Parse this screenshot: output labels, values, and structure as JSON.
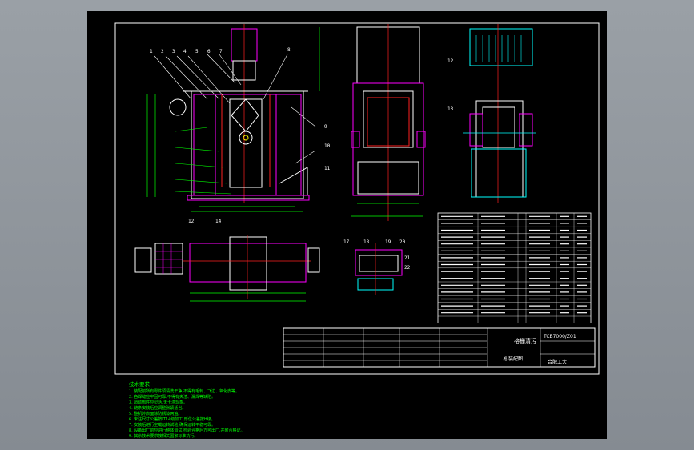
{
  "drawing": {
    "title_cn": "格栅清污",
    "part_no": "TCB7000/Z01",
    "stamp": "合肥工大",
    "scale_note": "总装配图"
  },
  "balloons_main": [
    "1",
    "2",
    "3",
    "4",
    "5",
    "6",
    "7",
    "8",
    "9",
    "10",
    "11"
  ],
  "balloons_side": [
    "12",
    "13"
  ],
  "balloons_plan": [
    "12",
    "14"
  ],
  "balloons_detail": [
    "17",
    "18",
    "19",
    "20",
    "21",
    "22"
  ],
  "bom_rows": 15,
  "notes": [
    "技术要求",
    "1. 装配前所有零件须清洗干净,不得有毛刺、飞边、氧化皮等。",
    "2. 各焊缝应牢固可靠,不得有夹渣、漏焊等缺陷。",
    "3. 运动部件应灵活,无卡滞现象。",
    "4. 链条安装后应调整张紧适当。",
    "5. 整机外表面涂防锈漆两遍。",
    "6. 未注尺寸公差按IT14级加工,形位公差按H级。",
    "7. 安装后进行空载运转试验,确保运转平稳可靠。",
    "8. 设备出厂前应进行整体调试,检验合格后方可出厂,并附合格证。",
    "9. 其余技术要求按相关国家标准执行。"
  ],
  "colors": {
    "frame": "#ffffff",
    "outline": "#ffffff",
    "magenta": "#ff00ff",
    "red": "#ff2020",
    "green": "#00ff00",
    "yellow": "#ffff00",
    "cyan": "#00ffff"
  }
}
